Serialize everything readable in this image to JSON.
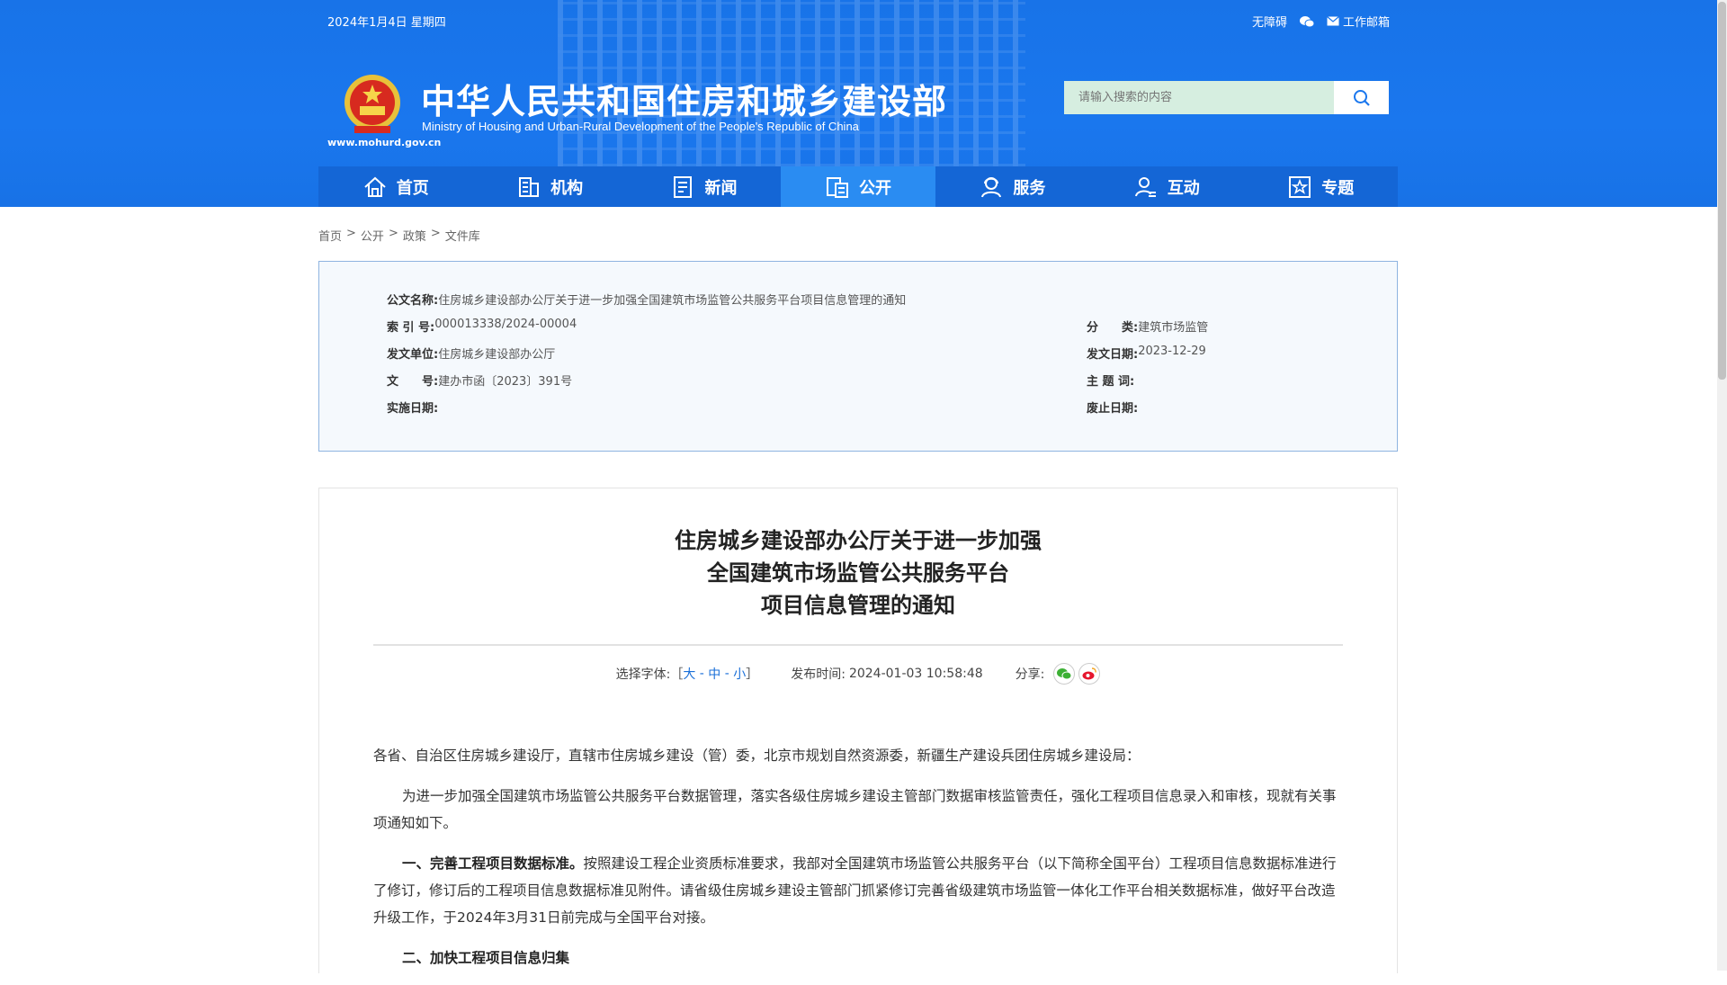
{
  "header": {
    "date": "2024年1月4日 星期四",
    "links": {
      "accessibility": "无障碍",
      "mail": "工作邮箱"
    },
    "title_cn": "中华人民共和国住房和城乡建设部",
    "title_en": "Ministry of Housing and Urban-Rural Development of the People's Republic of China",
    "site_url": "www.mohurd.gov.cn",
    "search_placeholder": "请输入搜索的内容"
  },
  "nav": [
    {
      "label": "首页",
      "icon": "home-icon"
    },
    {
      "label": "机构",
      "icon": "building-icon"
    },
    {
      "label": "新闻",
      "icon": "news-icon"
    },
    {
      "label": "公开",
      "icon": "document-icon"
    },
    {
      "label": "服务",
      "icon": "service-icon"
    },
    {
      "label": "互动",
      "icon": "interaction-icon"
    },
    {
      "label": "专题",
      "icon": "star-icon"
    }
  ],
  "nav_active": "公开",
  "breadcrumb": [
    "首页",
    "公开",
    "政策",
    "文件库"
  ],
  "breadcrumb_sep": ">",
  "meta": {
    "doc_name_label": "公文名称:",
    "doc_name": "住房城乡建设部办公厅关于进一步加强全国建筑市场监管公共服务平台项目信息管理的通知",
    "index_label": "索 引 号:",
    "index": "000013338/2024-00004",
    "category_label": "分　　类:",
    "category": "建筑市场监管",
    "issuer_label": "发文单位:",
    "issuer": "住房城乡建设部办公厅",
    "issue_date_label": "发文日期:",
    "issue_date": "2023-12-29",
    "doc_no_label": "文　　号:",
    "doc_no": "建办市函〔2023〕391号",
    "subject_label": "主 题 词:",
    "subject": "",
    "effective_label": "实施日期:",
    "effective": "",
    "expiry_label": "废止日期:",
    "expiry": ""
  },
  "article": {
    "title_lines": [
      "住房城乡建设部办公厅关于进一步加强",
      "全国建筑市场监管公共服务平台",
      "项目信息管理的通知"
    ],
    "font_label": "选择字体:",
    "font_open": "［",
    "font_large": "大",
    "font_medium": "中",
    "font_small": "小",
    "font_close": "］",
    "font_sep": " - ",
    "publish_label": "发布时间:",
    "publish_time": "2024-01-03 10:58:48",
    "share_label": "分享:",
    "paragraphs": {
      "p1": "各省、自治区住房城乡建设厅，直辖市住房城乡建设（管）委，北京市规划自然资源委，新疆生产建设兵团住房城乡建设局：",
      "p2": "为进一步加强全国建筑市场监管公共服务平台数据管理，落实各级住房城乡建设主管部门数据审核监管责任，强化工程项目信息录入和审核，现就有关事项通知如下。",
      "p3_bold": "一、完善工程项目数据标准。",
      "p3": "按照建设工程企业资质标准要求，我部对全国建筑市场监管公共服务平台（以下简称全国平台）工程项目信息数据标准进行了修订，修订后的工程项目信息数据标准见附件。请省级住房城乡建设主管部门抓紧修订完善省级建筑市场监管一体化工作平台相关数据标准，做好平台改造升级工作，于2024年3月31日前完成与全国平台对接。",
      "p4_bold": "二、加快工程项目信息归集"
    }
  },
  "colors": {
    "header_blue": "#1a77ee",
    "nav_blue": "#1466d6",
    "nav_active": "#2a8cf2",
    "link_blue": "#1a6fd8"
  }
}
